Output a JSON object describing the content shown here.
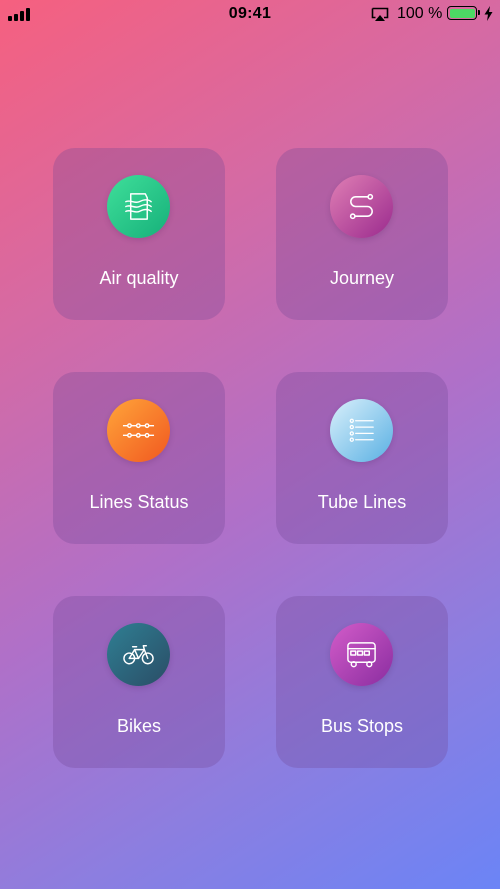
{
  "status_bar": {
    "time": "09:41",
    "battery_percent": "100 %",
    "battery_level": 1.0,
    "battery_color": "#4cd964",
    "icons": [
      "signal-bars-icon",
      "airplay-icon",
      "battery-icon",
      "charging-bolt-icon"
    ]
  },
  "menu": {
    "tiles": [
      {
        "label": "Air quality",
        "icon": "air-quality-icon",
        "color_start": "#3fdf9a",
        "color_end": "#16b07a"
      },
      {
        "label": "Journey",
        "icon": "journey-route-icon",
        "color_start": "#e07fb4",
        "color_end": "#9a2a8e"
      },
      {
        "label": "Lines Status",
        "icon": "lines-status-icon",
        "color_start": "#ffa53a",
        "color_end": "#f15820"
      },
      {
        "label": "Tube Lines",
        "icon": "tube-lines-list-icon",
        "color_start": "#d9f0fb",
        "color_end": "#5ab0e3"
      },
      {
        "label": "Bikes",
        "icon": "bike-icon",
        "color_start": "#2f7f93",
        "color_end": "#2a4d66"
      },
      {
        "label": "Bus Stops",
        "icon": "bus-icon",
        "color_start": "#d35cc9",
        "color_end": "#8a2da0"
      }
    ]
  }
}
